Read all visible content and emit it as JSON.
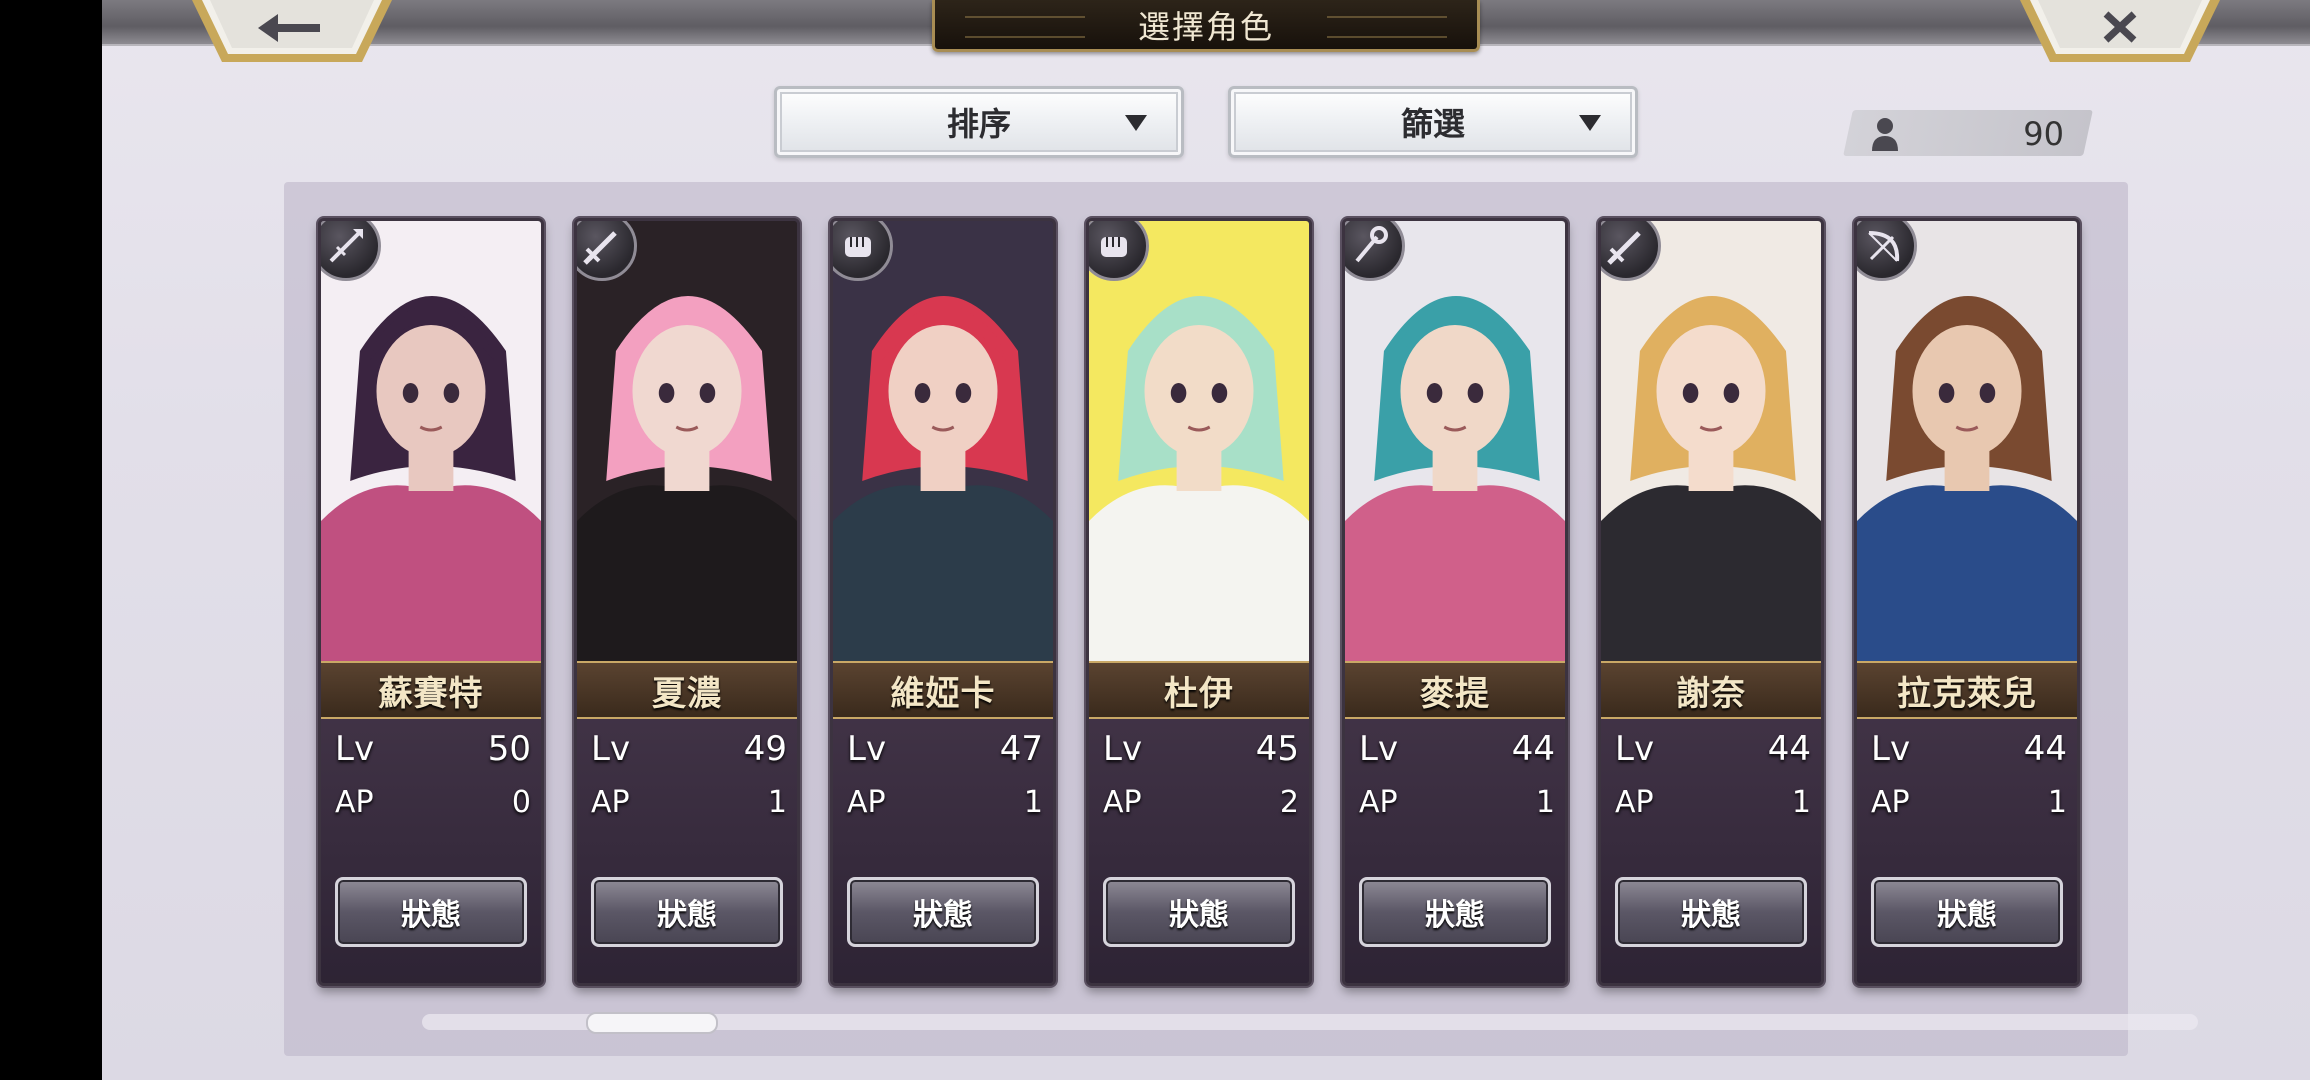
{
  "header": {
    "title": "選擇角色"
  },
  "controls": {
    "sort_label": "排序",
    "filter_label": "篩選",
    "roster_count": "90"
  },
  "labels": {
    "level": "Lv",
    "ap": "AP",
    "status_button": "狀態"
  },
  "characters": [
    {
      "name": "蘇賽特",
      "level": "50",
      "ap": "0",
      "role_icon": "spear-icon",
      "palette": [
        "#f4eef3",
        "#3a2440",
        "#c05080",
        "#e8c8c0"
      ]
    },
    {
      "name": "夏濃",
      "level": "49",
      "ap": "1",
      "role_icon": "sword-icon",
      "palette": [
        "#2a2226",
        "#f3a0c0",
        "#1e1a1c",
        "#f0d8d0"
      ]
    },
    {
      "name": "維婭卡",
      "level": "47",
      "ap": "1",
      "role_icon": "fist-icon",
      "palette": [
        "#3a3246",
        "#d83850",
        "#2c3c4a",
        "#f0d0c4"
      ]
    },
    {
      "name": "杜伊",
      "level": "45",
      "ap": "2",
      "role_icon": "fist-icon",
      "palette": [
        "#f4e860",
        "#a8e0c8",
        "#f4f4f0",
        "#f2dcc8"
      ]
    },
    {
      "name": "麥提",
      "level": "44",
      "ap": "1",
      "role_icon": "staff-icon",
      "palette": [
        "#e8e6ec",
        "#3aa0a8",
        "#d0608a",
        "#f0d8c8"
      ]
    },
    {
      "name": "謝奈",
      "level": "44",
      "ap": "1",
      "role_icon": "sword-icon",
      "palette": [
        "#f0eae4",
        "#e0b060",
        "#2c2a30",
        "#f4dccc"
      ]
    },
    {
      "name": "拉克萊兒",
      "level": "44",
      "ap": "1",
      "role_icon": "bow-icon",
      "palette": [
        "#e8e4e6",
        "#7a4a30",
        "#2a4c8a",
        "#e8c8b0"
      ]
    }
  ],
  "scroll": {
    "position_fraction": 0.1
  }
}
